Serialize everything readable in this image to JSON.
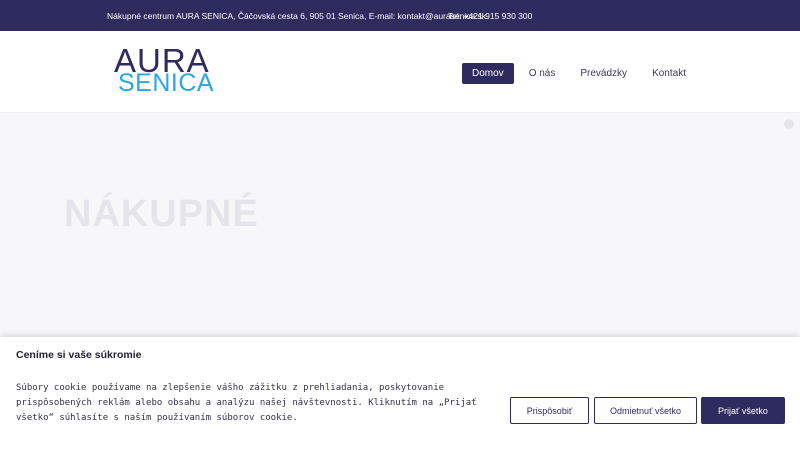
{
  "topbar": {
    "info": "Nákupné centrum AURA SENICA, Čáčovská cesta 6, 905 01 Senica, E-mail: kontakt@aurasenica.sk",
    "phone": "Tel: +421 915 930 300"
  },
  "logo": {
    "line1": "AURA",
    "line2": "SENICA"
  },
  "nav": {
    "items": [
      {
        "label": "Domov",
        "active": true
      },
      {
        "label": "O nás",
        "active": false
      },
      {
        "label": "Prevádzky",
        "active": false
      },
      {
        "label": "Kontakt",
        "active": false
      }
    ]
  },
  "hero": {
    "headline": "NÁKUPNÉ"
  },
  "cookie": {
    "title": "Ceníme si vaše súkromie",
    "text": "Súbory cookie používame na zlepšenie vášho zážitku z prehliadania, poskytovanie prispôsobených reklám alebo obsahu a analýzu našej návštevnosti. Kliknutím na „Prijať všetko“ súhlasíte s naším používaním súborov cookie.",
    "customize_label": "Prispôsobiť",
    "reject_label": "Odmietnuť všetko",
    "accept_label": "Prijať všetko"
  },
  "colors": {
    "primary": "#2e2b5e",
    "accent": "#2aa7df"
  }
}
